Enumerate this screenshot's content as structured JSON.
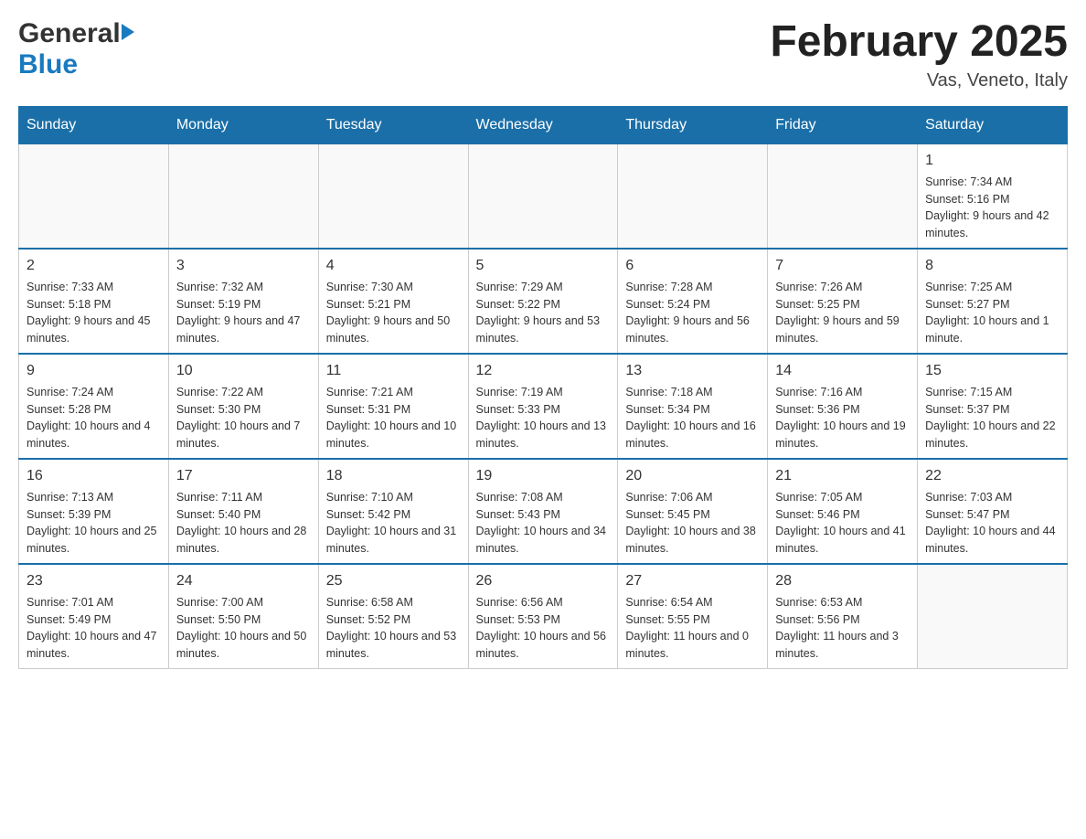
{
  "header": {
    "month_title": "February 2025",
    "location": "Vas, Veneto, Italy",
    "logo_general": "General",
    "logo_blue": "Blue"
  },
  "weekdays": [
    "Sunday",
    "Monday",
    "Tuesday",
    "Wednesday",
    "Thursday",
    "Friday",
    "Saturday"
  ],
  "weeks": [
    {
      "days": [
        {
          "date": "",
          "info": ""
        },
        {
          "date": "",
          "info": ""
        },
        {
          "date": "",
          "info": ""
        },
        {
          "date": "",
          "info": ""
        },
        {
          "date": "",
          "info": ""
        },
        {
          "date": "",
          "info": ""
        },
        {
          "date": "1",
          "info": "Sunrise: 7:34 AM\nSunset: 5:16 PM\nDaylight: 9 hours and 42 minutes."
        }
      ]
    },
    {
      "days": [
        {
          "date": "2",
          "info": "Sunrise: 7:33 AM\nSunset: 5:18 PM\nDaylight: 9 hours and 45 minutes."
        },
        {
          "date": "3",
          "info": "Sunrise: 7:32 AM\nSunset: 5:19 PM\nDaylight: 9 hours and 47 minutes."
        },
        {
          "date": "4",
          "info": "Sunrise: 7:30 AM\nSunset: 5:21 PM\nDaylight: 9 hours and 50 minutes."
        },
        {
          "date": "5",
          "info": "Sunrise: 7:29 AM\nSunset: 5:22 PM\nDaylight: 9 hours and 53 minutes."
        },
        {
          "date": "6",
          "info": "Sunrise: 7:28 AM\nSunset: 5:24 PM\nDaylight: 9 hours and 56 minutes."
        },
        {
          "date": "7",
          "info": "Sunrise: 7:26 AM\nSunset: 5:25 PM\nDaylight: 9 hours and 59 minutes."
        },
        {
          "date": "8",
          "info": "Sunrise: 7:25 AM\nSunset: 5:27 PM\nDaylight: 10 hours and 1 minute."
        }
      ]
    },
    {
      "days": [
        {
          "date": "9",
          "info": "Sunrise: 7:24 AM\nSunset: 5:28 PM\nDaylight: 10 hours and 4 minutes."
        },
        {
          "date": "10",
          "info": "Sunrise: 7:22 AM\nSunset: 5:30 PM\nDaylight: 10 hours and 7 minutes."
        },
        {
          "date": "11",
          "info": "Sunrise: 7:21 AM\nSunset: 5:31 PM\nDaylight: 10 hours and 10 minutes."
        },
        {
          "date": "12",
          "info": "Sunrise: 7:19 AM\nSunset: 5:33 PM\nDaylight: 10 hours and 13 minutes."
        },
        {
          "date": "13",
          "info": "Sunrise: 7:18 AM\nSunset: 5:34 PM\nDaylight: 10 hours and 16 minutes."
        },
        {
          "date": "14",
          "info": "Sunrise: 7:16 AM\nSunset: 5:36 PM\nDaylight: 10 hours and 19 minutes."
        },
        {
          "date": "15",
          "info": "Sunrise: 7:15 AM\nSunset: 5:37 PM\nDaylight: 10 hours and 22 minutes."
        }
      ]
    },
    {
      "days": [
        {
          "date": "16",
          "info": "Sunrise: 7:13 AM\nSunset: 5:39 PM\nDaylight: 10 hours and 25 minutes."
        },
        {
          "date": "17",
          "info": "Sunrise: 7:11 AM\nSunset: 5:40 PM\nDaylight: 10 hours and 28 minutes."
        },
        {
          "date": "18",
          "info": "Sunrise: 7:10 AM\nSunset: 5:42 PM\nDaylight: 10 hours and 31 minutes."
        },
        {
          "date": "19",
          "info": "Sunrise: 7:08 AM\nSunset: 5:43 PM\nDaylight: 10 hours and 34 minutes."
        },
        {
          "date": "20",
          "info": "Sunrise: 7:06 AM\nSunset: 5:45 PM\nDaylight: 10 hours and 38 minutes."
        },
        {
          "date": "21",
          "info": "Sunrise: 7:05 AM\nSunset: 5:46 PM\nDaylight: 10 hours and 41 minutes."
        },
        {
          "date": "22",
          "info": "Sunrise: 7:03 AM\nSunset: 5:47 PM\nDaylight: 10 hours and 44 minutes."
        }
      ]
    },
    {
      "days": [
        {
          "date": "23",
          "info": "Sunrise: 7:01 AM\nSunset: 5:49 PM\nDaylight: 10 hours and 47 minutes."
        },
        {
          "date": "24",
          "info": "Sunrise: 7:00 AM\nSunset: 5:50 PM\nDaylight: 10 hours and 50 minutes."
        },
        {
          "date": "25",
          "info": "Sunrise: 6:58 AM\nSunset: 5:52 PM\nDaylight: 10 hours and 53 minutes."
        },
        {
          "date": "26",
          "info": "Sunrise: 6:56 AM\nSunset: 5:53 PM\nDaylight: 10 hours and 56 minutes."
        },
        {
          "date": "27",
          "info": "Sunrise: 6:54 AM\nSunset: 5:55 PM\nDaylight: 11 hours and 0 minutes."
        },
        {
          "date": "28",
          "info": "Sunrise: 6:53 AM\nSunset: 5:56 PM\nDaylight: 11 hours and 3 minutes."
        },
        {
          "date": "",
          "info": ""
        }
      ]
    }
  ]
}
